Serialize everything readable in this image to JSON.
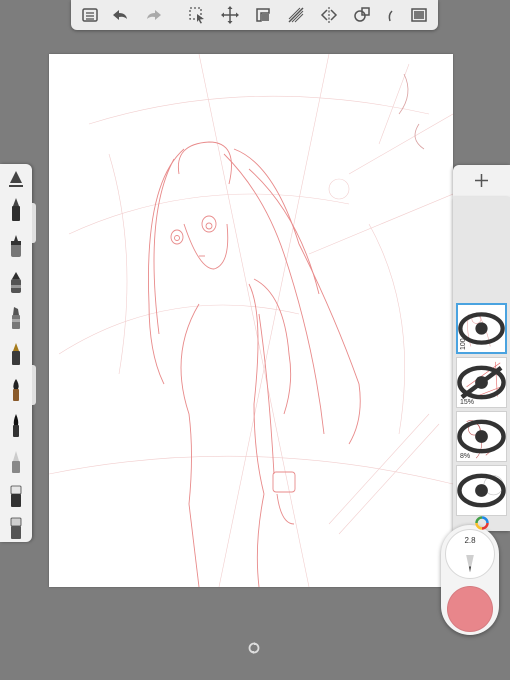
{
  "toolbar": {
    "icons": [
      "list-icon",
      "undo-icon",
      "redo-icon",
      "select-icon",
      "move-icon",
      "ruler-icon",
      "perspective-icon",
      "symmetry-icon",
      "shapes-icon",
      "fill-icon",
      "fullscreen-icon"
    ]
  },
  "brushes": [
    "pencil",
    "ballpoint",
    "marker",
    "chisel-marker",
    "airbrush",
    "paint-brush",
    "ink-brush",
    "smudge",
    "eraser",
    "hard-eraser",
    "brush-library"
  ],
  "layers": [
    {
      "name": "layer-1",
      "opacity_label": "100",
      "visible": true,
      "selected": true
    },
    {
      "name": "layer-2",
      "opacity_label": "15%",
      "visible": false,
      "selected": false
    },
    {
      "name": "layer-3",
      "opacity_label": "8%",
      "visible": true,
      "selected": false
    },
    {
      "name": "layer-4",
      "opacity_label": "",
      "visible": true,
      "selected": false
    }
  ],
  "brush_puck": {
    "size_label": "2.8",
    "color": "#e8868b",
    "opacity_percent": 100
  },
  "colors": {
    "background": "#7d7d7d",
    "canvas": "#ffffff",
    "sketch": "#e57373",
    "selection": "#4aa3e0"
  }
}
